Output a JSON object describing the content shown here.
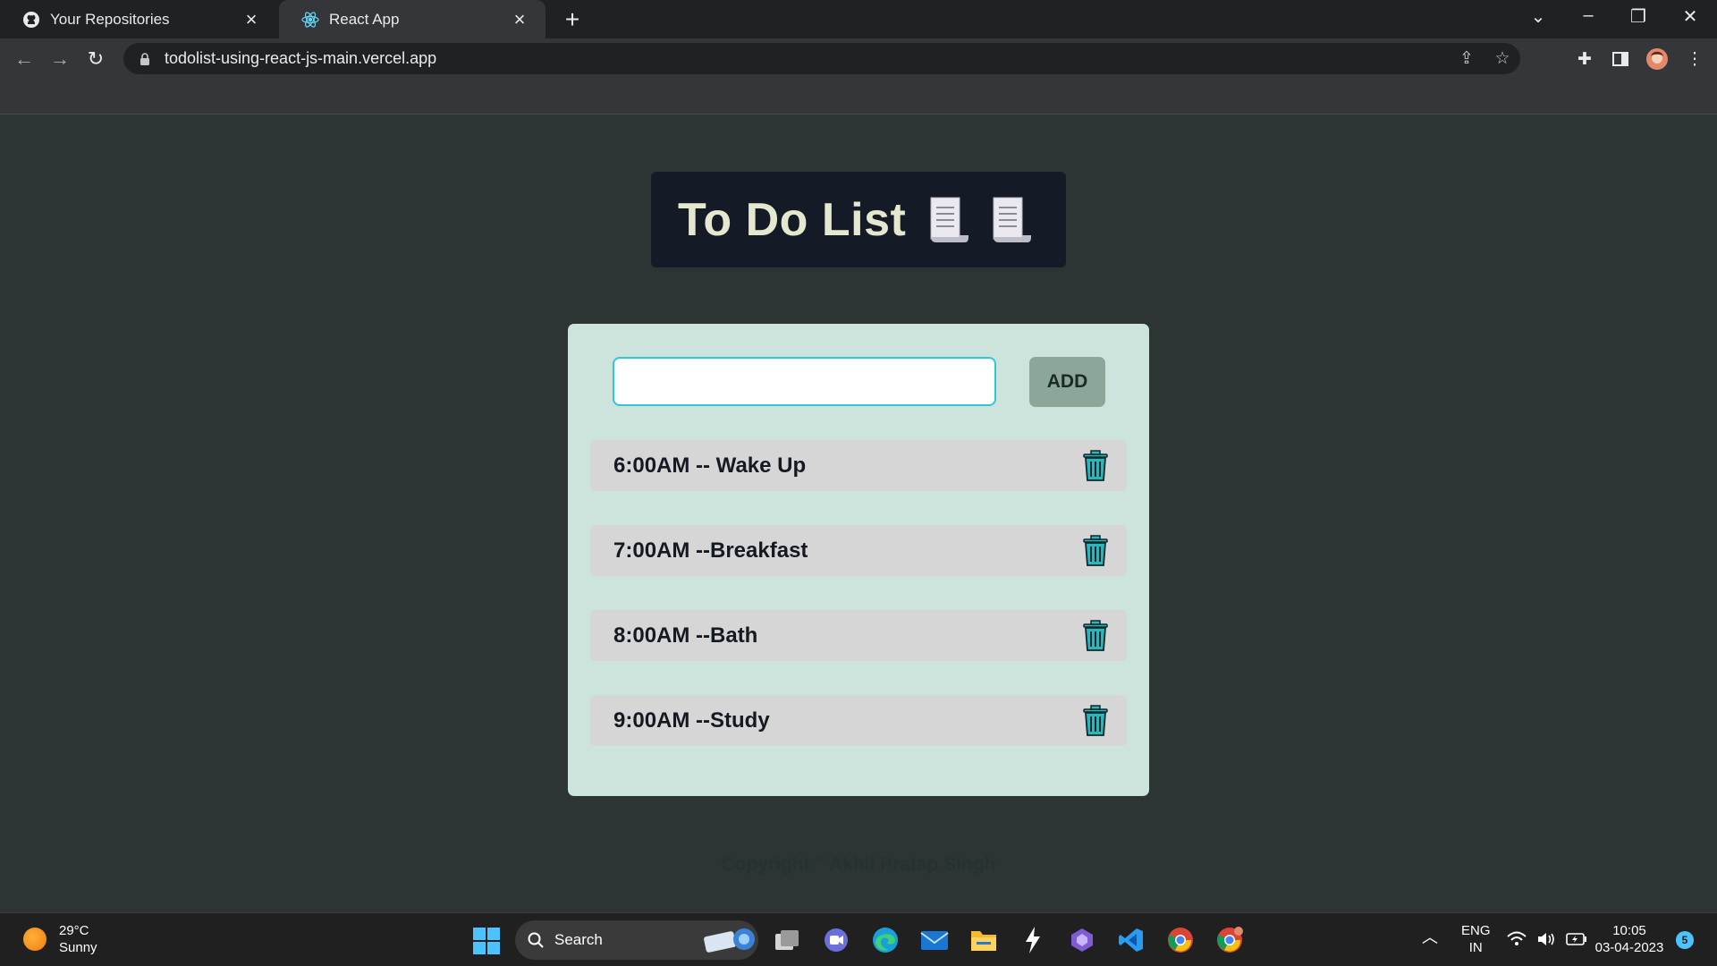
{
  "browser": {
    "tabs": [
      {
        "label": "Your Repositories",
        "icon": "github-icon"
      },
      {
        "label": "React App",
        "icon": "react-icon"
      }
    ],
    "url": "todolist-using-react-js-main.vercel.app"
  },
  "page": {
    "title": "To Do List",
    "input": {
      "value": "",
      "placeholder": ""
    },
    "add_label": "ADD",
    "items": [
      {
        "text": "6:00AM -- Wake Up"
      },
      {
        "text": "7:00AM --Breakfast"
      },
      {
        "text": "8:00AM --Bath"
      },
      {
        "text": "9:00AM --Study"
      }
    ],
    "copyright": {
      "label": "Copyright",
      "symbol": "©",
      "author": "Akhil Pratap Singh"
    }
  },
  "taskbar": {
    "weather": {
      "temp": "29°C",
      "condition": "Sunny"
    },
    "search_label": "Search",
    "language": {
      "line1": "ENG",
      "line2": "IN"
    },
    "clock": {
      "time": "10:05",
      "date": "03-04-2023"
    },
    "notification_count": "5"
  },
  "colors": {
    "page_bg": "#2c3533",
    "title_bg": "#141a26",
    "title_text": "#e4e8cf",
    "card_bg": "#cde4dd",
    "item_bg": "#d6d6d6",
    "add_button_bg": "#8ca69a",
    "input_border": "#2fc7d6",
    "trash_icon": "#2ab6bd"
  }
}
